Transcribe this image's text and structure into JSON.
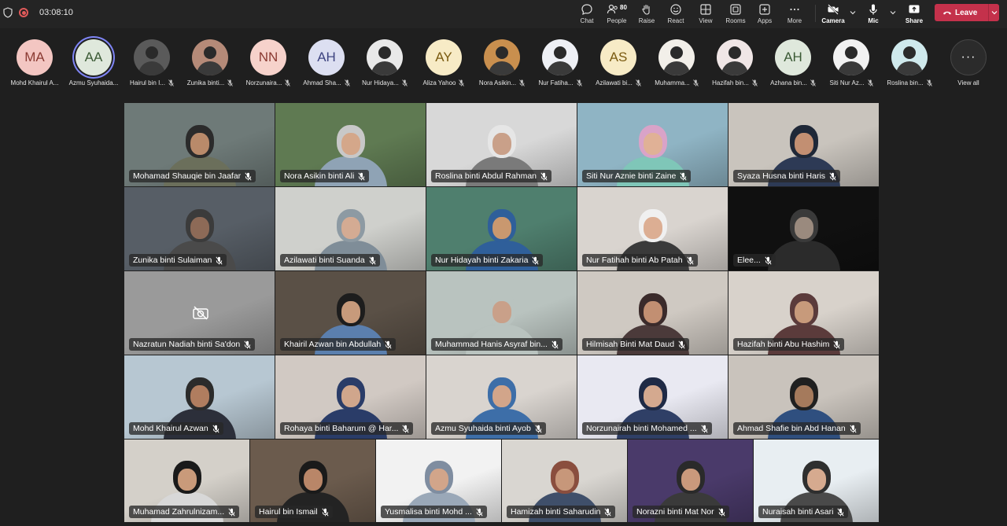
{
  "topbar": {
    "timer": "03:08:10",
    "chat": "Chat",
    "people": "People",
    "people_count": "80",
    "raise": "Raise",
    "react": "React",
    "view": "View",
    "rooms": "Rooms",
    "apps": "Apps",
    "more": "More",
    "camera": "Camera",
    "mic": "Mic",
    "share": "Share",
    "leave": "Leave"
  },
  "strip": {
    "participants": [
      {
        "initials": "MA",
        "name": "Mohd Khairul A...",
        "color": "#f3c6c2",
        "text": "#8a3a32"
      },
      {
        "initials": "AA",
        "name": "Azmu Syuhaida...",
        "color": "#dfe8dc",
        "text": "#3b5a35"
      },
      {
        "initials": "",
        "name": "Hairul bin I...",
        "color": "#5a5a5a"
      },
      {
        "initials": "",
        "name": "Zunika binti...",
        "color": "#b58a78"
      },
      {
        "initials": "NN",
        "name": "Norzunaira...",
        "color": "#f6d2cb",
        "text": "#8a3a32"
      },
      {
        "initials": "AH",
        "name": "Ahmad Sha...",
        "color": "#dcdff1",
        "text": "#3e4480"
      },
      {
        "initials": "",
        "name": "Nur Hidaya...",
        "color": "#e9e9e9"
      },
      {
        "initials": "AY",
        "name": "Aliza Yahoo",
        "color": "#f7ebc6",
        "text": "#7a5a10"
      },
      {
        "initials": "",
        "name": "Nora Asikin...",
        "color": "#c98f4e"
      },
      {
        "initials": "",
        "name": "Nur Fatiha...",
        "color": "#eef0f5"
      },
      {
        "initials": "AS",
        "name": "Azilawati bi...",
        "color": "#f7ebc6",
        "text": "#7a5a10"
      },
      {
        "initials": "",
        "name": "Muhamma...",
        "color": "#f2efe9"
      },
      {
        "initials": "",
        "name": "Hazifah bin...",
        "color": "#f0e6e6"
      },
      {
        "initials": "AH",
        "name": "Azhana bin...",
        "color": "#dfe8dc",
        "text": "#3b5a35"
      },
      {
        "initials": "",
        "name": "Siti Nur Az...",
        "color": "#f2f2f2"
      },
      {
        "initials": "",
        "name": "Roslina bin...",
        "color": "#cfe9ec"
      }
    ],
    "view_all": "View all"
  },
  "tiles": [
    {
      "name": "Mohamad Shauqie bin  Jaafar",
      "bg": "#6e7a78",
      "skin": "#b98a6a",
      "top": "#2b2b2b",
      "cloth": "#6b6f5b"
    },
    {
      "name": "Nora Asikin binti Ali",
      "bg": "#5f7a52",
      "skin": "#d4a78a",
      "top": "#c8c8c8",
      "cloth": "#8fa3b5"
    },
    {
      "name": "Roslina binti Abdul Rahman",
      "bg": "#d8d8d8",
      "skin": "#c9a089",
      "top": "#e6e6e6",
      "cloth": "#7a7a7a"
    },
    {
      "name": "Siti Nur Aznie binti Zaine",
      "bg": "#8fb4c4",
      "skin": "#e0b196",
      "top": "#d9a3c8",
      "cloth": "#7fc6b8"
    },
    {
      "name": "Syaza Husna binti Haris",
      "bg": "#c9c4bd",
      "skin": "#c28f72",
      "top": "#1f2838",
      "cloth": "#2d3a55"
    },
    {
      "name": "Zunika binti Sulaiman",
      "bg": "#575e66",
      "skin": "#8d6a57",
      "top": "#3b3b3b",
      "cloth": "#4a4a4a"
    },
    {
      "name": "Azilawati binti Suanda",
      "bg": "#cfd0cc",
      "skin": "#d4ab93",
      "top": "#8d9aa3",
      "cloth": "#7f8d98"
    },
    {
      "name": "Nur Hidayah binti Zakaria",
      "bg": "#4f7f6e",
      "skin": "#c9986f",
      "top": "#2f5f9a",
      "cloth": "#2f5f9a"
    },
    {
      "name": "Nur Fatihah binti Ab Patah",
      "bg": "#d9d4cf",
      "skin": "#dcae93",
      "top": "#f0f0f0",
      "cloth": "#3a3a3a"
    },
    {
      "name": "Elee...",
      "bg": "#101010",
      "skin": "#9a8a7e",
      "top": "#3a3a3a",
      "cloth": "#2b2b2b"
    },
    {
      "name": "Nazratun Nadiah binti Sa'don",
      "bg": "#9a9a9a",
      "camoff": true
    },
    {
      "name": "Khairil Azwan bin Abdullah",
      "bg": "#5a5046",
      "skin": "#c79a7b",
      "top": "#1d1d1d",
      "cloth": "#5b7fae"
    },
    {
      "name": "Muhammad Hanis Asyraf bin...",
      "bg": "#b9c3bf",
      "skin": "#c9a089",
      "top": "#b9c3bf",
      "cloth": "#b9c3bf"
    },
    {
      "name": "Hilmisah Binti Mat Daud",
      "bg": "#cfc9c2",
      "skin": "#c28f72",
      "top": "#3b2b2b",
      "cloth": "#4b3a3a"
    },
    {
      "name": "Hazifah binti Abu Hashim",
      "bg": "#d8d2cb",
      "skin": "#c79a7b",
      "top": "#5b3b3b",
      "cloth": "#5b3b3b"
    },
    {
      "name": "Mohd Khairul Azwan",
      "bg": "#b7c7d2",
      "skin": "#b07d5f",
      "top": "#2b2b2b",
      "cloth": "#2c2f3a"
    },
    {
      "name": "Rohaya binti Baharum @ Har...",
      "bg": "#d1c9c3",
      "skin": "#d0a68c",
      "top": "#2a3c68",
      "cloth": "#2a3c68"
    },
    {
      "name": "Azmu Syuhaida binti Ayob",
      "bg": "#d9d4cf",
      "skin": "#d2a58a",
      "top": "#3d6ea8",
      "cloth": "#3d6ea8"
    },
    {
      "name": "Norzunairah binti Mohamed ...",
      "bg": "#e9e9f2",
      "skin": "#d4a98f",
      "top": "#1f2a45",
      "cloth": "#2f3f66"
    },
    {
      "name": "Ahmad Shafie bin Abd Hanan",
      "bg": "#c9c3bc",
      "skin": "#a57a5c",
      "top": "#202020",
      "cloth": "#2f4f7f"
    },
    {
      "name": "Muhamad Zahrulnizam...",
      "bg": "#d4d0c9",
      "skin": "#c99a7a",
      "top": "#1a1a1a",
      "cloth": "#d8d8d8"
    },
    {
      "name": "Hairul bin Ismail",
      "bg": "#6b5b4d",
      "skin": "#b98668",
      "top": "#1a1a1a",
      "cloth": "#232323"
    },
    {
      "name": "Yusmalisa binti Mohd ...",
      "bg": "#f2f2f2",
      "skin": "#d2a58a",
      "top": "#7f8da0",
      "cloth": "#9aa8b8"
    },
    {
      "name": "Hamizah binti Saharudin",
      "bg": "#d9d6d1",
      "skin": "#c7977a",
      "top": "#8a4e3e",
      "cloth": "#3f4f6a"
    },
    {
      "name": "Norazni binti Mat Nor",
      "bg": "#4a3a6a",
      "skin": "#c9997c",
      "top": "#2a2a2a",
      "cloth": "#3a3a3a"
    },
    {
      "name": "Nuraisah binti Asari",
      "bg": "#e8eef2",
      "skin": "#d6aa8f",
      "top": "#2f2f2f",
      "cloth": "#4a4a4a"
    }
  ]
}
